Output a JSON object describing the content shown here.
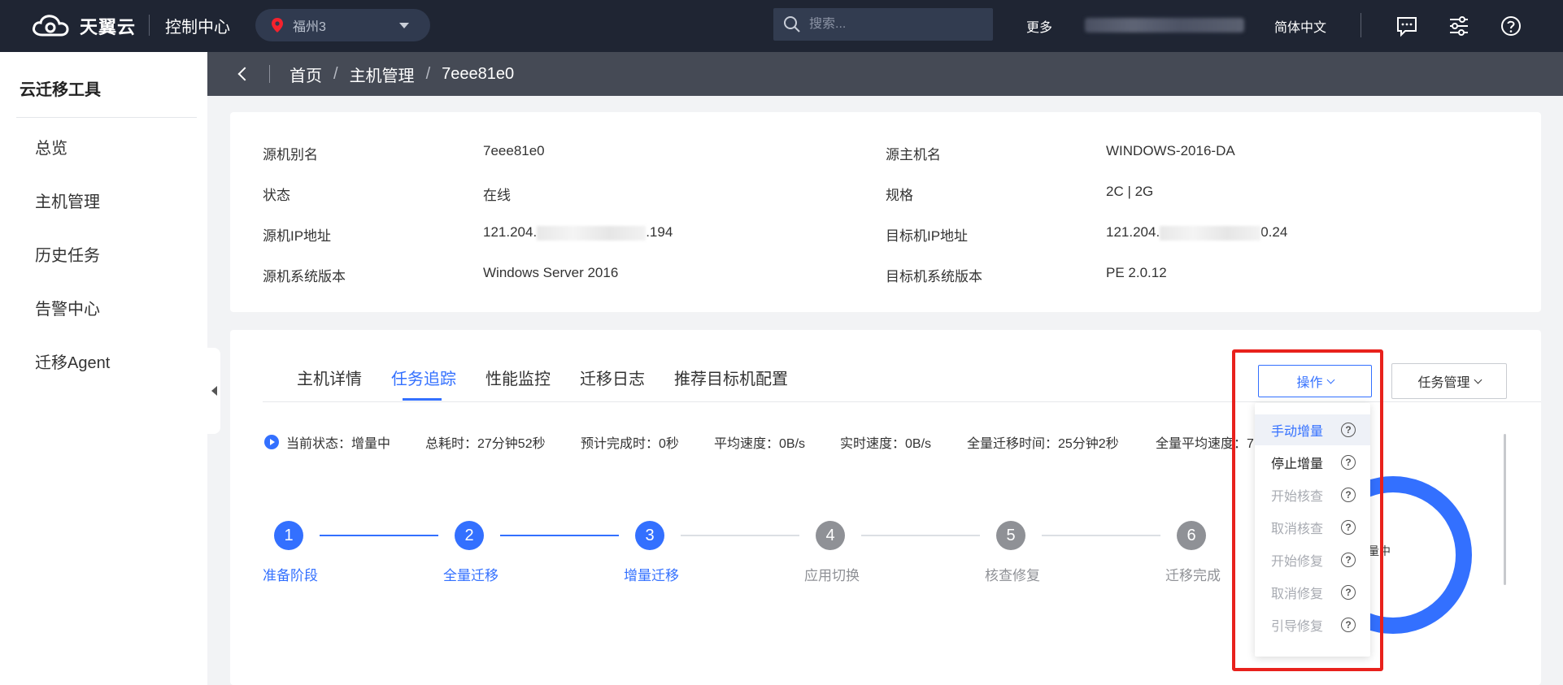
{
  "header": {
    "logo_text": "天翼云",
    "console": "控制中心",
    "region": "福州3",
    "search_placeholder": "搜索...",
    "more": "更多",
    "language": "简体中文",
    "icons": [
      "message-icon",
      "settings-sliders-icon",
      "help-icon"
    ]
  },
  "sidebar": {
    "title": "云迁移工具",
    "items": [
      {
        "label": "总览"
      },
      {
        "label": "主机管理"
      },
      {
        "label": "历史任务"
      },
      {
        "label": "告警中心"
      },
      {
        "label": "迁移Agent"
      }
    ]
  },
  "breadcrumb": {
    "items": [
      "首页",
      "主机管理"
    ],
    "current": "7eee81e0",
    "separator": "/"
  },
  "info": {
    "left": [
      {
        "label": "源机别名",
        "value": "7eee81e0"
      },
      {
        "label": "状态",
        "value": "在线"
      },
      {
        "label": "源机IP地址",
        "value_prefix": "121.204.",
        "value_suffix": ".194"
      },
      {
        "label": "源机系统版本",
        "value": "Windows Server 2016"
      }
    ],
    "right": [
      {
        "label": "源主机名",
        "value": "WINDOWS-2016-DA"
      },
      {
        "label": "规格",
        "value": "2C | 2G"
      },
      {
        "label": "目标机IP地址",
        "value_prefix": "121.204.",
        "value_suffix": "0.24"
      },
      {
        "label": "目标机系统版本",
        "value": "PE 2.0.12"
      }
    ]
  },
  "tabs": [
    {
      "label": "主机详情",
      "active": false
    },
    {
      "label": "任务追踪",
      "active": true
    },
    {
      "label": "性能监控",
      "active": false
    },
    {
      "label": "迁移日志",
      "active": false
    },
    {
      "label": "推荐目标机配置",
      "active": false
    }
  ],
  "buttons": {
    "operate": "操作",
    "task_manage": "任务管理"
  },
  "status": {
    "current": "当前状态：增量中",
    "total_time": "总耗时：27分钟52秒",
    "eta": "预计完成时：0秒",
    "avg_speed": "平均速度：0B/s",
    "realtime_speed": "实时速度：0B/s",
    "full_time": "全量迁移时间：25分钟2秒",
    "full_avg_speed": "全量平均速度：7"
  },
  "steps": [
    {
      "num": "1",
      "label": "准备阶段",
      "done": true
    },
    {
      "num": "2",
      "label": "全量迁移",
      "done": true
    },
    {
      "num": "3",
      "label": "增量迁移",
      "done": true
    },
    {
      "num": "4",
      "label": "应用切换",
      "done": false
    },
    {
      "num": "5",
      "label": "核查修复",
      "done": false
    },
    {
      "num": "6",
      "label": "迁移完成",
      "done": false
    }
  ],
  "ring_label": "量中",
  "dropdown": [
    {
      "label": "手动增量",
      "state": "highlight"
    },
    {
      "label": "停止增量",
      "state": "enabled"
    },
    {
      "label": "开始核查",
      "state": "disabled"
    },
    {
      "label": "取消核查",
      "state": "disabled"
    },
    {
      "label": "开始修复",
      "state": "disabled"
    },
    {
      "label": "取消修复",
      "state": "disabled"
    },
    {
      "label": "引导修复",
      "state": "disabled"
    }
  ],
  "colors": {
    "topbar": "#1f2533",
    "primary": "#3370ff",
    "disabled": "#a8abb2",
    "highlight_border": "#e8211c"
  }
}
